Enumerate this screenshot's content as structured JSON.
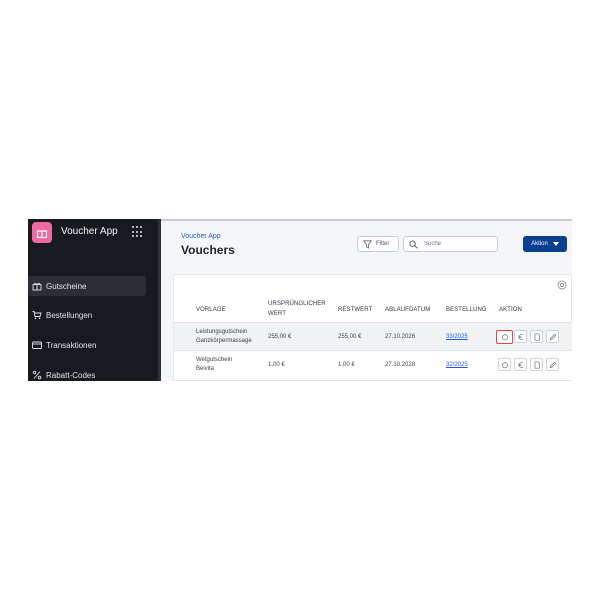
{
  "sidebar": {
    "app_name": "Voucher App",
    "items": [
      {
        "label": "Gutscheine",
        "icon": "gift-icon",
        "active": true
      },
      {
        "label": "Bestellungen",
        "icon": "cart-icon",
        "active": false
      },
      {
        "label": "Transaktionen",
        "icon": "card-icon",
        "active": false
      },
      {
        "label": "Rabatt-Codes",
        "icon": "percent-icon",
        "active": false
      }
    ]
  },
  "header": {
    "breadcrumb": "Voucher App",
    "title": "Vouchers",
    "filter_label": "Filter",
    "search_placeholder": "Suche",
    "action_label": "Aktion"
  },
  "table": {
    "columns": [
      "VORLAGE",
      "URSPRÜNGLICHER WERT",
      "RESTWERT",
      "ABLAUFDATUM",
      "BESTELLUNG",
      "AKTION"
    ],
    "column_lines": {
      "original_value": [
        "URSPRÜNGLICHER",
        "WERT"
      ]
    },
    "rows": [
      {
        "template": [
          "Leistungsgutschein",
          "Ganzkörpermassage"
        ],
        "original_value": "255,00 €",
        "remaining_value": "255,00 €",
        "expiry_date": "27.10.2026",
        "order": "33/2025"
      },
      {
        "template": [
          "Wetgutschein",
          "Beivita"
        ],
        "original_value": "1,00 €",
        "remaining_value": "1,00 €",
        "expiry_date": "27.10.2028",
        "order": "32/2025"
      }
    ],
    "action_icons": [
      "redeem-icon",
      "euro-icon",
      "document-icon",
      "edit-icon"
    ]
  },
  "colors": {
    "sidebar_bg": "#171a1f",
    "accent_blue": "#0a3f91",
    "logo_pink": "#ee6aa4",
    "highlight_red": "#e1453a",
    "link_blue": "#1f5ad1"
  }
}
